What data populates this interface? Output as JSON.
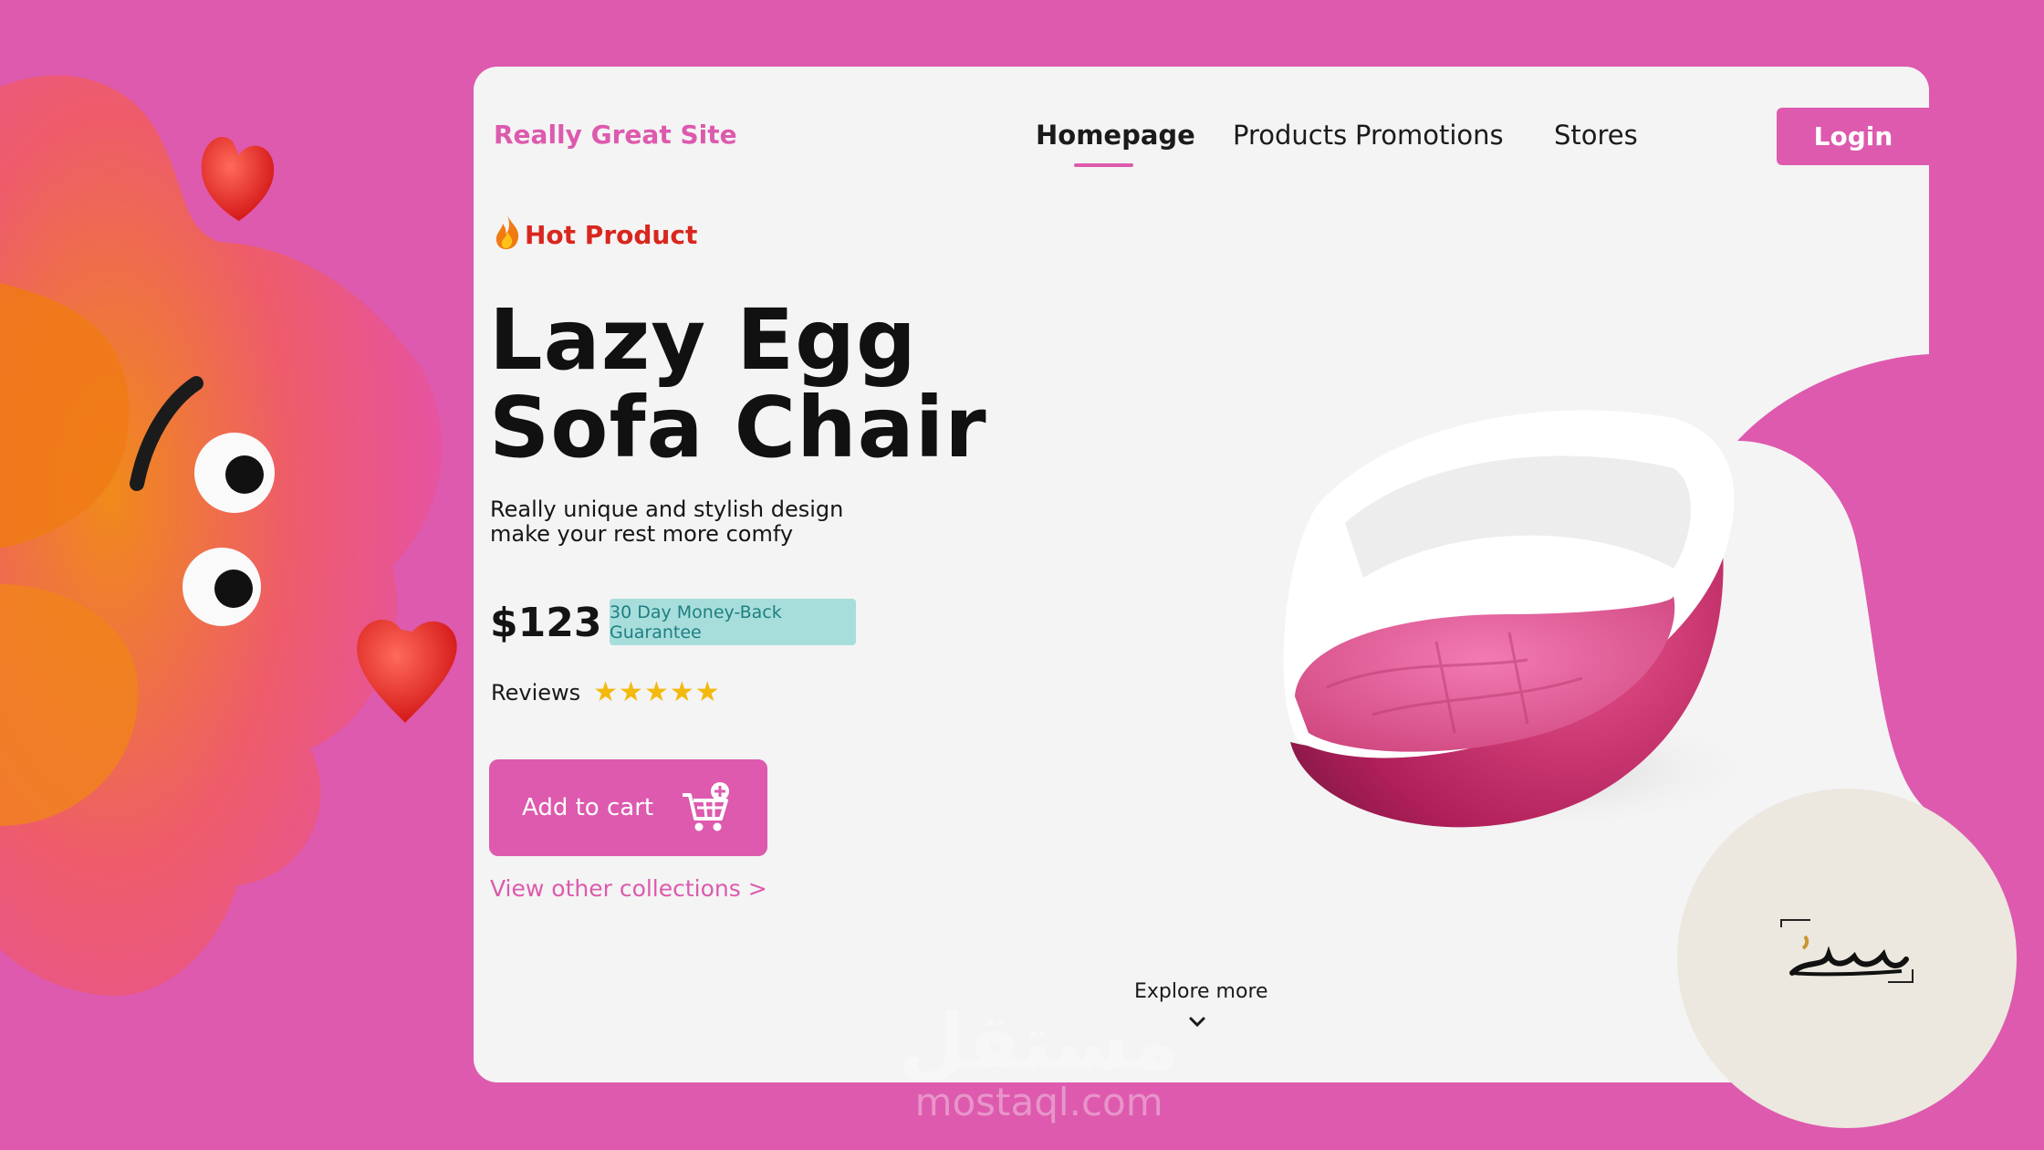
{
  "header": {
    "brand": "Really Great Site",
    "nav": [
      "Homepage",
      "Products",
      "Promotions",
      "Stores"
    ],
    "active_nav": "Homepage",
    "login_label": "Login"
  },
  "hero": {
    "hot_label": "Hot Product",
    "title_line1": "Lazy Egg",
    "title_line2": "Sofa Chair",
    "tagline_line1": "Really unique and stylish design",
    "tagline_line2": "make your rest more comfy",
    "price": "$123",
    "guarantee": "30 Day Money-Back Guarantee",
    "reviews_label": "Reviews",
    "rating": 5,
    "rating_max": 5,
    "add_to_cart_label": "Add to cart",
    "collections_link": "View other collections >",
    "explore_label": "Explore more"
  },
  "icons": [
    "flame-icon",
    "star-icon",
    "cart-add-icon",
    "chevron-down-icon"
  ],
  "colors": {
    "accent": "#DD5AAE",
    "card_bg": "#F4F4F4",
    "hot": "#D9261E",
    "guarantee_bg": "#A7DEDB",
    "guarantee_text": "#1E7F83",
    "star": "#F3B90C"
  },
  "watermark": {
    "arabic": "مستقل",
    "latin": "mostaql.com"
  }
}
